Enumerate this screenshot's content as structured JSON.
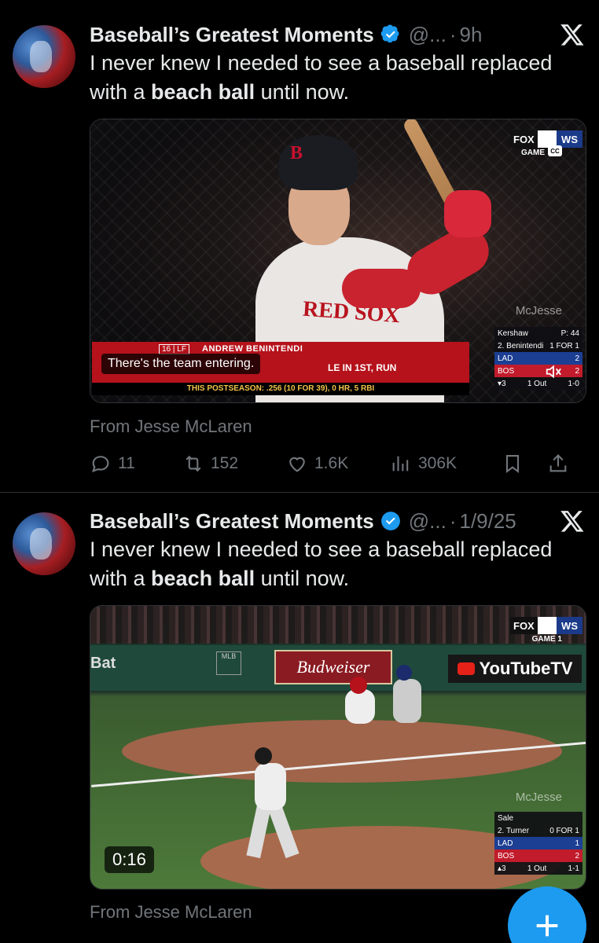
{
  "posts": [
    {
      "author": "Baseball’s Greatest Moments",
      "handle": "@...",
      "dot": "·",
      "time": "9h",
      "text_before": "I never knew I needed to see a baseball replaced with a ",
      "text_bold": "beach ball",
      "text_after": " until now.",
      "media": {
        "broadcast_bug": "FOX",
        "series_bug": "WS",
        "game_label": "GAME",
        "cc": "CC",
        "watermark": "McJesse",
        "lower_third": {
          "number_tag": "16 | LF",
          "player": "ANDREW BENINTENDI",
          "stat": "LE IN 1ST, RUN",
          "postseason": "THIS POSTSEASON: .256 (10 FOR 39), 0 HR, 5 RBI"
        },
        "caption": "There's the team entering.",
        "scorebug": {
          "pitcher": "Kershaw",
          "pitch_count": "P: 44",
          "batter": "2. Benintendi",
          "batter_line": "1 FOR 1",
          "team1": "LAD",
          "score1": "2",
          "team2": "BOS",
          "score2": "2",
          "inning": "▾3",
          "outs": "1 Out",
          "count": "1-0"
        }
      },
      "from": "From Jesse McLaren",
      "actions": {
        "replies": "11",
        "reposts": "152",
        "likes": "1.6K",
        "views": "306K"
      }
    },
    {
      "author": "Baseball’s Greatest Moments",
      "handle": "@...",
      "dot": "·",
      "time": "1/9/25",
      "text_before": "I never knew I needed to see a baseball replaced with a ",
      "text_bold": "beach ball",
      "text_after": " until now.",
      "media": {
        "broadcast_bug": "FOX",
        "series_bug": "WS",
        "game_label": "GAME 1",
        "watermark": "McJesse",
        "sign_bat": "Bat",
        "sign_budweiser": "Budweiser",
        "sign_youtube": "YouTubeTV",
        "sign_mlb": "MLB",
        "duration": "0:16",
        "scorebug": {
          "pitcher": "Sale",
          "batter": "2. Turner",
          "batter_line": "0 FOR 1",
          "team1": "LAD",
          "score1": "1",
          "team2": "BOS",
          "score2": "2",
          "inning": "▴3",
          "outs": "1 Out",
          "count": "1-1"
        }
      },
      "from": "From Jesse McLaren"
    }
  ],
  "icons": {
    "verified": "verified-badge-icon",
    "x_logo": "x-logo-icon",
    "reply": "reply-icon",
    "repost": "repost-icon",
    "like": "heart-icon",
    "views": "views-icon",
    "bookmark": "bookmark-icon",
    "share": "share-icon",
    "compose": "plus-icon"
  },
  "colors": {
    "accent": "#1d9bf0",
    "muted": "#71767b",
    "text": "#e7e9ea",
    "background": "#000000"
  }
}
